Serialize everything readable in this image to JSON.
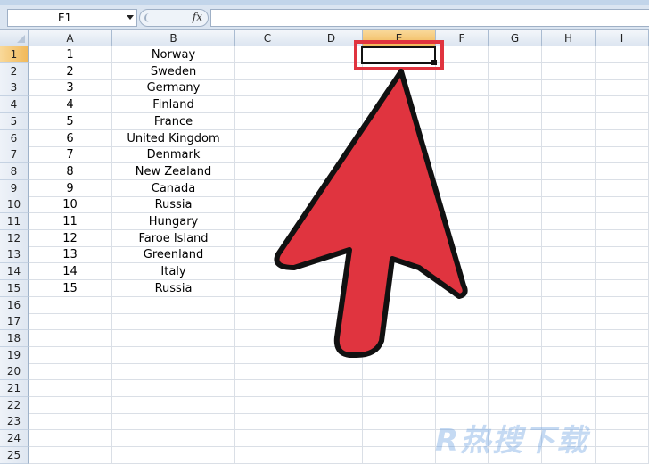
{
  "name_box": {
    "value": "E1"
  },
  "formula_bar": {
    "fx_label": "fx",
    "value": ""
  },
  "columns": [
    {
      "label": "A",
      "width": 94
    },
    {
      "label": "B",
      "width": 138
    },
    {
      "label": "C",
      "width": 73
    },
    {
      "label": "D",
      "width": 70
    },
    {
      "label": "E",
      "width": 82
    },
    {
      "label": "F",
      "width": 59
    },
    {
      "label": "G",
      "width": 60
    },
    {
      "label": "H",
      "width": 60
    },
    {
      "label": "I",
      "width": 60
    }
  ],
  "rows": [
    {
      "n": "1",
      "a": "1",
      "b": "Norway"
    },
    {
      "n": "2",
      "a": "2",
      "b": "Sweden"
    },
    {
      "n": "3",
      "a": "3",
      "b": "Germany"
    },
    {
      "n": "4",
      "a": "4",
      "b": "Finland"
    },
    {
      "n": "5",
      "a": "5",
      "b": "France"
    },
    {
      "n": "6",
      "a": "6",
      "b": "United Kingdom"
    },
    {
      "n": "7",
      "a": "7",
      "b": "Denmark"
    },
    {
      "n": "8",
      "a": "8",
      "b": "New Zealand"
    },
    {
      "n": "9",
      "a": "9",
      "b": "Canada"
    },
    {
      "n": "10",
      "a": "10",
      "b": "Russia"
    },
    {
      "n": "11",
      "a": "11",
      "b": "Hungary"
    },
    {
      "n": "12",
      "a": "12",
      "b": "Faroe Island"
    },
    {
      "n": "13",
      "a": "13",
      "b": "Greenland"
    },
    {
      "n": "14",
      "a": "14",
      "b": "Italy"
    },
    {
      "n": "15",
      "a": "15",
      "b": "Russia"
    },
    {
      "n": "16",
      "a": "",
      "b": ""
    },
    {
      "n": "17",
      "a": "",
      "b": ""
    },
    {
      "n": "18",
      "a": "",
      "b": ""
    },
    {
      "n": "19",
      "a": "",
      "b": ""
    },
    {
      "n": "20",
      "a": "",
      "b": ""
    },
    {
      "n": "21",
      "a": "",
      "b": ""
    },
    {
      "n": "22",
      "a": "",
      "b": ""
    },
    {
      "n": "23",
      "a": "",
      "b": ""
    },
    {
      "n": "24",
      "a": "",
      "b": ""
    },
    {
      "n": "25",
      "a": "",
      "b": ""
    }
  ],
  "selected": {
    "column": "E",
    "row": "1"
  },
  "colors": {
    "accent": "#e0343f",
    "outline": "#111111",
    "header": "#dde6f1",
    "active_header": "#f1b95a"
  },
  "annotation": {
    "icon": "red-pointer-arrow-icon",
    "highlight": "red-selection-box"
  },
  "watermark": {
    "text": "R热搜下载"
  }
}
